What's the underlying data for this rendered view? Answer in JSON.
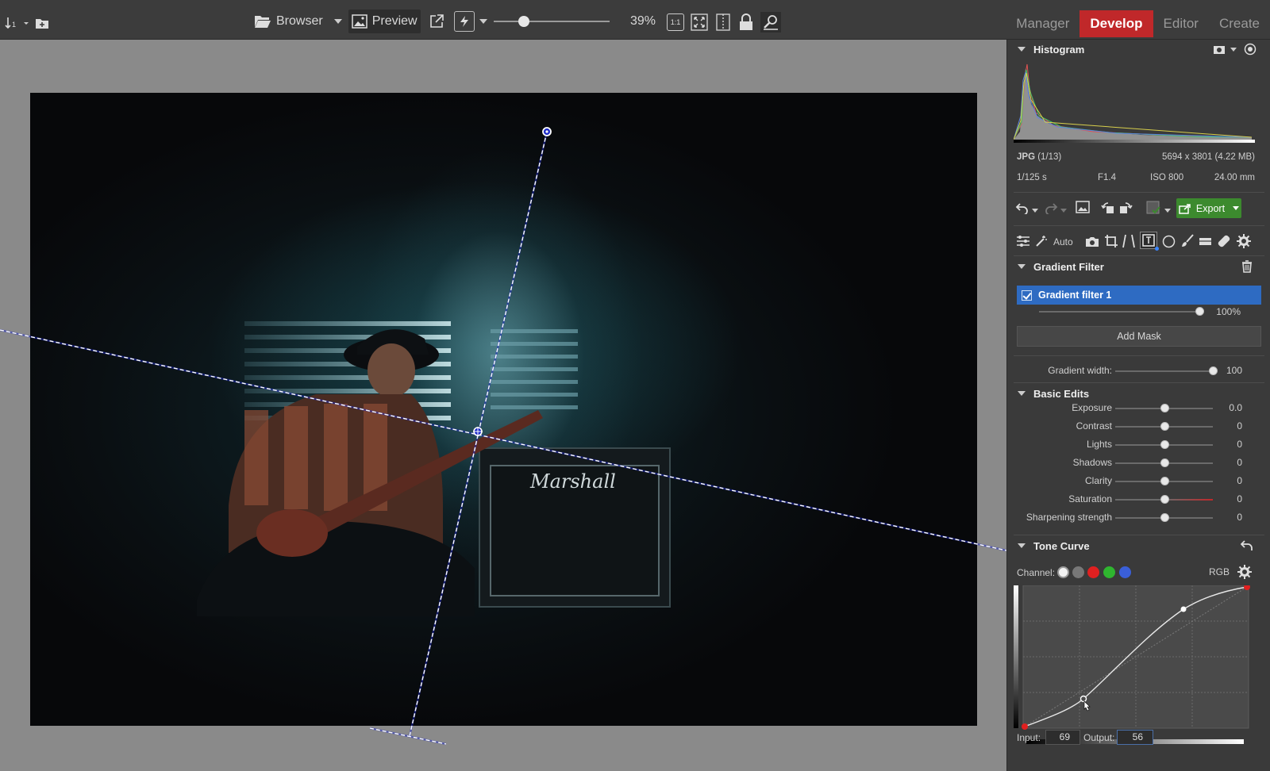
{
  "toolbar": {
    "browser_label": "Browser",
    "preview_label": "Preview",
    "zoom_level": "39%",
    "one_to_one_label": "1:1",
    "zoom_slider_fraction": 0.26
  },
  "modes": {
    "manager": "Manager",
    "develop": "Develop",
    "editor": "Editor",
    "create": "Create"
  },
  "histogram": {
    "title": "Histogram",
    "format": "JPG",
    "index": "(1/13)",
    "dimensions": "5694 x 3801 (4.22 MB)",
    "shutter": "1/125 s",
    "aperture": "F1.4",
    "iso": "ISO 800",
    "focal": "24.00 mm"
  },
  "actions": {
    "export_label": "Export"
  },
  "tools": {
    "auto_label": "Auto"
  },
  "gradient_filter": {
    "title": "Gradient Filter",
    "item_label": "Gradient filter 1",
    "opacity": "100%",
    "opacity_fraction": 1.0,
    "add_mask_label": "Add Mask",
    "width_label": "Gradient width:",
    "width_value": "100",
    "width_fraction": 1.0
  },
  "basic_edits": {
    "title": "Basic Edits",
    "rows": [
      {
        "label": "Exposure",
        "value": "0.0"
      },
      {
        "label": "Contrast",
        "value": "0"
      },
      {
        "label": "Lights",
        "value": "0"
      },
      {
        "label": "Shadows",
        "value": "0"
      },
      {
        "label": "Clarity",
        "value": "0"
      },
      {
        "label": "Saturation",
        "value": "0"
      },
      {
        "label": "Sharpening strength",
        "value": "0"
      }
    ]
  },
  "tone_curve": {
    "title": "Tone Curve",
    "channel_label": "Channel:",
    "channel_mode": "RGB",
    "input_label": "Input:",
    "input_value": "69",
    "output_label": "Output:",
    "output_value": "56",
    "colors": {
      "red": "#e02020",
      "green": "#2fb52f",
      "blue": "#3a5fd8",
      "gray": "#777777"
    }
  },
  "colors": {
    "accent": "#c0282a",
    "selection": "#2e6bc2",
    "export": "#3c8a2e"
  }
}
